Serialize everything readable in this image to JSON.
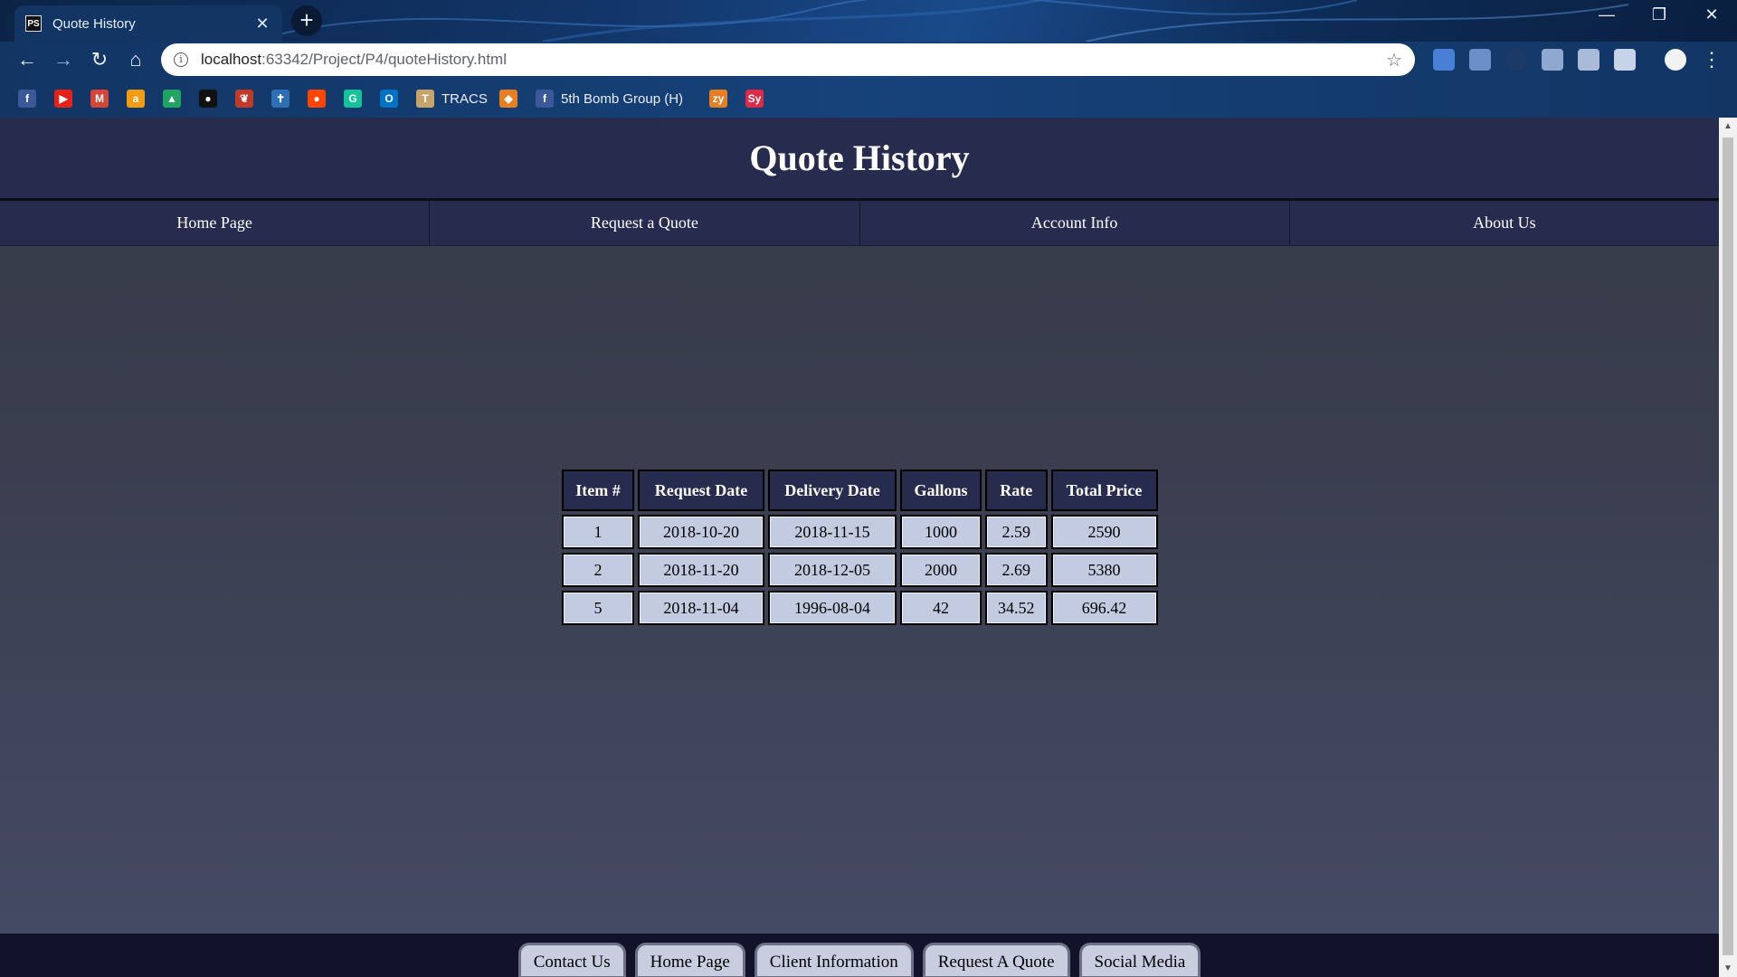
{
  "browser": {
    "tab_title": "Quote History",
    "tab_favicon_text": "PS",
    "tab_close": "✕",
    "new_tab": "+",
    "window_controls": {
      "minimize": "—",
      "restore": "❐",
      "close": "✕"
    },
    "nav": {
      "back": "←",
      "forward": "→",
      "reload": "↻",
      "home": "⌂"
    },
    "url_host": "localhost",
    "url_rest": ":63342/Project/P4/quoteHistory.html",
    "star": "☆",
    "menu": "⋮",
    "bookmarks": [
      {
        "icon": "facebook-icon",
        "text": "f",
        "color": "#3b5998",
        "label": ""
      },
      {
        "icon": "youtube-icon",
        "text": "▶",
        "color": "#e62117",
        "label": ""
      },
      {
        "icon": "gmail-icon",
        "text": "M",
        "color": "#d44638",
        "label": ""
      },
      {
        "icon": "amazon-icon",
        "text": "a",
        "color": "#f39c12",
        "label": ""
      },
      {
        "icon": "drive-icon",
        "text": "▲",
        "color": "#1fa463",
        "label": ""
      },
      {
        "icon": "github-icon",
        "text": "●",
        "color": "#111111",
        "label": ""
      },
      {
        "icon": "scratch-icon",
        "text": "❦",
        "color": "#c0392b",
        "label": ""
      },
      {
        "icon": "stickman-icon",
        "text": "✝",
        "color": "#2d6fb7",
        "label": ""
      },
      {
        "icon": "reddit-icon",
        "text": "●",
        "color": "#ff4500",
        "label": ""
      },
      {
        "icon": "grammarly-icon",
        "text": "G",
        "color": "#15c39a",
        "label": ""
      },
      {
        "icon": "outlook-icon",
        "text": "O",
        "color": "#0072c6",
        "label": ""
      },
      {
        "icon": "tracs-icon",
        "text": "T",
        "color": "#c8a46b",
        "label": "TRACS"
      },
      {
        "icon": "diamond-icon",
        "text": "◆",
        "color": "#e67e22",
        "label": ""
      },
      {
        "icon": "facebook-icon",
        "text": "f",
        "color": "#3b5998",
        "label": "5th Bomb Group (H)"
      },
      {
        "icon": "zybooks-icon",
        "text": "zy",
        "color": "#e67e22",
        "label": ""
      },
      {
        "icon": "symbolab-icon",
        "text": "Sy",
        "color": "#dd2a46",
        "label": ""
      }
    ]
  },
  "page": {
    "title": "Quote History",
    "nav": [
      "Home Page",
      "Request a Quote",
      "Account Info",
      "About Us"
    ],
    "table": {
      "headers": [
        "Item #",
        "Request Date",
        "Delivery Date",
        "Gallons",
        "Rate",
        "Total Price"
      ],
      "rows": [
        [
          "1",
          "2018-10-20",
          "2018-11-15",
          "1000",
          "2.59",
          "2590"
        ],
        [
          "2",
          "2018-11-20",
          "2018-12-05",
          "2000",
          "2.69",
          "5380"
        ],
        [
          "5",
          "2018-11-04",
          "1996-08-04",
          "42",
          "34.52",
          "696.42"
        ]
      ]
    },
    "footer": [
      "Contact Us",
      "Home Page",
      "Client Information",
      "Request A Quote",
      "Social Media"
    ]
  },
  "colors": {
    "header_bg": "#272b4d",
    "cell_bg": "#c3cbe0",
    "footer_bg": "#12132a"
  }
}
